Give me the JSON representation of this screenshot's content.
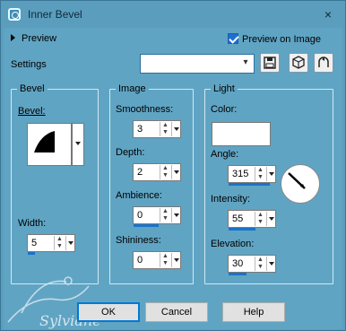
{
  "window": {
    "title": "Inner Bevel",
    "close_glyph": "×"
  },
  "preview": {
    "label": "Preview",
    "preview_on_image_label": "Preview on Image",
    "preview_on_image_checked": true
  },
  "settings": {
    "label": "Settings",
    "value": ""
  },
  "toolbar": {
    "buttons": [
      "save-preset-icon",
      "resources-cube-icon",
      "reset-icon"
    ]
  },
  "bevel_group": {
    "title": "Bevel",
    "bevel_label_prefix": "Bevel:",
    "width_label": "Width:",
    "width_value": "5"
  },
  "image_group": {
    "title": "Image",
    "smoothness_label": "Smoothness:",
    "smoothness_value": "3",
    "depth_label": "Depth:",
    "depth_value": "2",
    "ambience_label": "Ambience:",
    "ambience_value": "0",
    "shininess_label": "Shininess:",
    "shininess_value": "0"
  },
  "light_group": {
    "title": "Light",
    "color_label": "Color:",
    "color_value": "#ffffff",
    "angle_label": "Angle:",
    "angle_value": "315",
    "intensity_label": "Intensity:",
    "intensity_value": "55",
    "elevation_label": "Elevation:",
    "elevation_value": "30"
  },
  "buttons": {
    "ok": "OK",
    "cancel": "Cancel",
    "help": "Help"
  },
  "watermark": {
    "text": "Sylviane"
  },
  "colors": {
    "window_bg": "#60a4c3",
    "accent": "#1a73c9"
  }
}
